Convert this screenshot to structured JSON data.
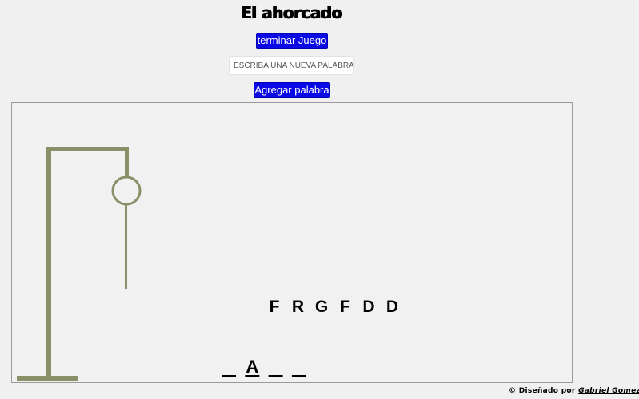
{
  "header": {
    "title": "El ahorcado"
  },
  "controls": {
    "end_game_label": "terminar Juego",
    "new_word_placeholder": "ESCRIBA UNA NUEVA PALABRA",
    "new_word_value": "",
    "add_word_label": "Agregar palabra"
  },
  "game": {
    "wrong_letters": [
      "F",
      "R",
      "G",
      "F",
      "D",
      "D"
    ],
    "word_slots": [
      "",
      "A",
      "",
      ""
    ],
    "gallows_color": "#8b8f68",
    "text_color": "#000000"
  },
  "footer": {
    "prefix": "© Diseñado por ",
    "author": "Gabriel Gomez"
  }
}
